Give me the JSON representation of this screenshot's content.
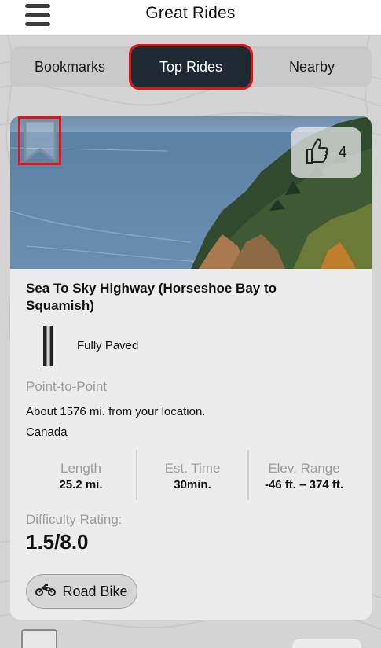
{
  "header": {
    "title": "Great Rides",
    "menu_icon": "hamburger-menu-icon"
  },
  "tabs": [
    {
      "label": "Bookmarks",
      "active": false
    },
    {
      "label": "Top Rides",
      "active": true
    },
    {
      "label": "Nearby",
      "active": false
    }
  ],
  "ride": {
    "name": "Sea To Sky Highway (Horseshoe Bay to Squamish)",
    "likes": "4",
    "surface": "Fully Paved",
    "route_type": "Point-to-Point",
    "distance_text": "About 1576 mi. from your location.",
    "region": "Canada",
    "stats": [
      {
        "label": "Length",
        "value": "25.2 mi."
      },
      {
        "label": "Est. Time",
        "value": "30min."
      },
      {
        "label": "Elev. Range",
        "value": "-46 ft. – 374 ft."
      }
    ],
    "difficulty_label": "Difficulty Rating:",
    "difficulty_value": "1.5/8.0",
    "bike_type": "Road Bike"
  },
  "colors": {
    "active_tab": "#1e2a33",
    "highlight": "#e01515",
    "muted_text": "#9c9c9c"
  }
}
